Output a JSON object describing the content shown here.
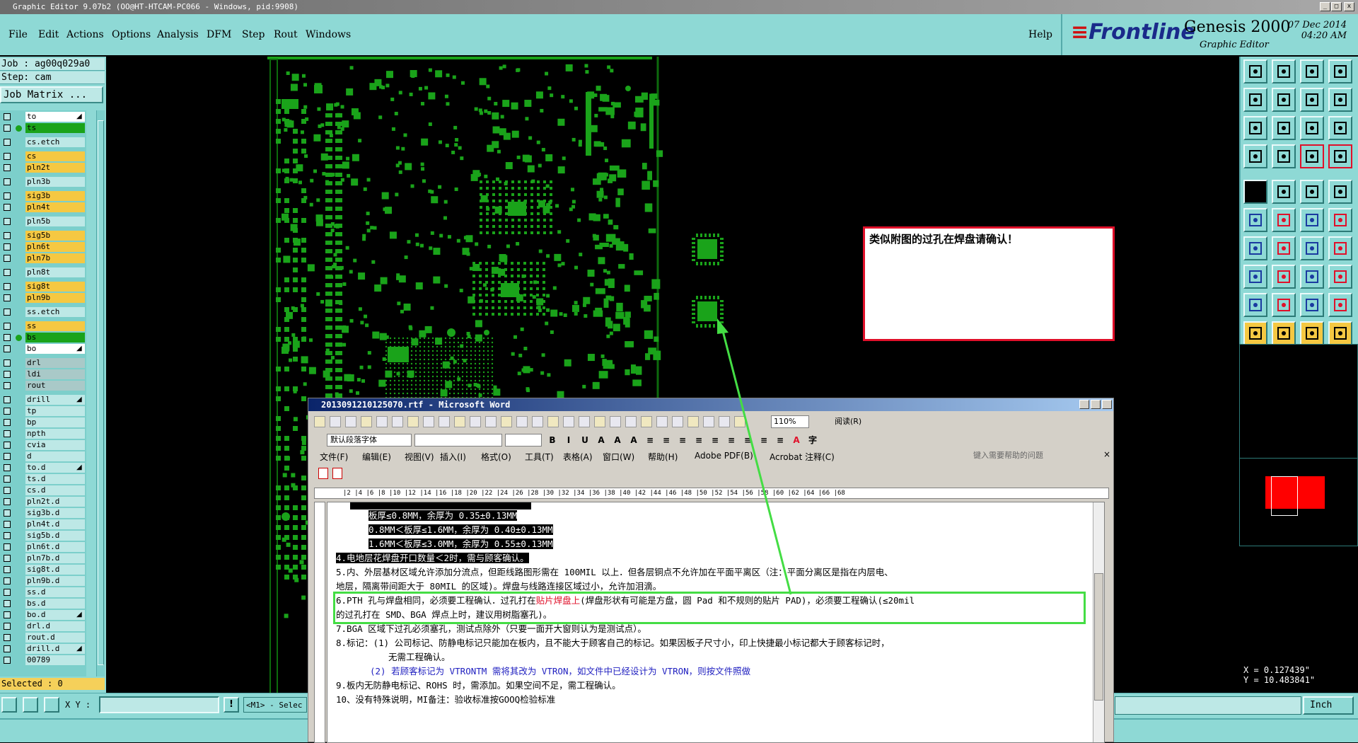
{
  "window": {
    "title": "Graphic Editor 9.07b2 (OO@HT-HTCAM-PC066 - Windows, pid:9908)",
    "controls": [
      "_",
      "□",
      "x"
    ]
  },
  "menu": {
    "items": [
      "File",
      "Edit",
      "Actions",
      "Options",
      "Analysis",
      "DFM",
      "Step",
      "Rout",
      "Windows"
    ],
    "help": "Help"
  },
  "brand": {
    "logo": "Frontline",
    "product": "Genesis 2000",
    "subtitle": "Graphic Editor",
    "date": "07 Dec 2014",
    "time": "04:20 AM"
  },
  "job": {
    "job_label": "Job : ag00q029a0",
    "step_label": "Step: cam",
    "matrix_button": "Job Matrix ..."
  },
  "layers": [
    {
      "name": "to",
      "style": "white",
      "arrow": true
    },
    {
      "name": "ts",
      "style": "green"
    },
    {
      "name": "cs.etch",
      "style": "cyan"
    },
    {
      "name": "cs",
      "style": "orange"
    },
    {
      "name": "pln2t",
      "style": "orange"
    },
    {
      "name": "pln3b",
      "style": "cyan"
    },
    {
      "name": "sig3b",
      "style": "orange"
    },
    {
      "name": "pln4t",
      "style": "orange"
    },
    {
      "name": "pln5b",
      "style": "cyan"
    },
    {
      "name": "sig5b",
      "style": "orange"
    },
    {
      "name": "pln6t",
      "style": "orange"
    },
    {
      "name": "pln7b",
      "style": "orange"
    },
    {
      "name": "pln8t",
      "style": "cyan"
    },
    {
      "name": "sig8t",
      "style": "orange"
    },
    {
      "name": "pln9b",
      "style": "orange"
    },
    {
      "name": "ss.etch",
      "style": "cyan"
    },
    {
      "name": "ss",
      "style": "orange"
    },
    {
      "name": "bs",
      "style": "green"
    },
    {
      "name": "bo",
      "style": "white",
      "arrow": true
    },
    {
      "name": "drl",
      "style": "grey"
    },
    {
      "name": "ldi",
      "style": "grey"
    },
    {
      "name": "rout",
      "style": "grey"
    },
    {
      "name": "drill",
      "style": "cyan",
      "arrow": true
    },
    {
      "name": "tp",
      "style": "cyan"
    },
    {
      "name": "bp",
      "style": "cyan"
    },
    {
      "name": "npth",
      "style": "cyan"
    },
    {
      "name": "cvia",
      "style": "cyan"
    },
    {
      "name": "d",
      "style": "cyan"
    },
    {
      "name": "to.d",
      "style": "cyan",
      "arrow": true
    },
    {
      "name": "ts.d",
      "style": "cyan"
    },
    {
      "name": "cs.d",
      "style": "cyan"
    },
    {
      "name": "pln2t.d",
      "style": "cyan"
    },
    {
      "name": "sig3b.d",
      "style": "cyan"
    },
    {
      "name": "pln4t.d",
      "style": "cyan"
    },
    {
      "name": "sig5b.d",
      "style": "cyan"
    },
    {
      "name": "pln6t.d",
      "style": "cyan"
    },
    {
      "name": "pln7b.d",
      "style": "cyan"
    },
    {
      "name": "sig8t.d",
      "style": "cyan"
    },
    {
      "name": "pln9b.d",
      "style": "cyan"
    },
    {
      "name": "ss.d",
      "style": "cyan"
    },
    {
      "name": "bs.d",
      "style": "cyan"
    },
    {
      "name": "bo.d",
      "style": "cyan",
      "arrow": true
    },
    {
      "name": "drl.d",
      "style": "cyan"
    },
    {
      "name": "rout.d",
      "style": "cyan"
    },
    {
      "name": "drill.d",
      "style": "cyan",
      "arrow": true
    },
    {
      "name": "00789",
      "style": "cyan"
    }
  ],
  "selected_label": "Selected : 0",
  "statusbar": {
    "xy_label": "X Y :",
    "xy_value": "",
    "mode_text": "<M1> - Selec",
    "units": "Inch"
  },
  "coords": {
    "x": "X = 0.127439\"",
    "y": "Y = 10.483841\""
  },
  "note": {
    "text": "类似附图的过孔在焊盘请确认！"
  },
  "word": {
    "title": "2013091210125070.rtf - Microsoft Word",
    "style_box": "默认段落字体",
    "zoom": "110%",
    "read_button": "阅读(R)",
    "menus": [
      "文件(F)",
      "编辑(E)",
      "视图(V)",
      "插入(I)",
      "格式(O)",
      "工具(T)",
      "表格(A)",
      "窗口(W)",
      "帮助(H)",
      "Adobe PDF(B)",
      "Acrobat 注释(C)"
    ],
    "help_placeholder": "键入需要帮助的问题",
    "ruler": "|2 |4 |6 |8 |10 |12 |14 |16 |18 |20 |22 |24 |26 |28 |30 |32 |34 |36 |38 |40 |42 |44 |46 |48 |50 |52 |54 |56 |58 |60 |62 |64 |66 |68",
    "lines": [
      "板厚≤0.8MM，余厚为 0.35±0.13MM",
      "0.8MM＜板厚≤1.6MM，余厚为 0.40±0.13MM",
      "1.6MM＜板厚≤3.0MM，余厚为 0.55±0.13MM",
      "4.电地层花焊盘开口数量＜2时，需与顾客确认。",
      "5.内、外层基材区域允许添加分流点，但距线路图形需在 100MIL 以上．但各层铜点不允许加在平面平离区（注：平面分离区是指在内层电、",
      "地层，隔离带间距大于 80MIL 的区域)。焊盘与线路连接区域过小，允许加泪滴。",
      "6.PTH 孔与焊盘相同，必须要工程确认．过孔打在",
      "贴片焊盘上",
      "(焊盘形状有可能是方盘，圆 Pad 和不规则的贴片 PAD)，必须要工程确认(≤20mil",
      "的过孔打在 SMD、BGA 焊点上时，建议用树脂塞孔)。",
      "7.BGA 区域下过孔必须塞孔，测试点除外（只要一面开大窗则认为是测试点）。",
      "8.标记：(1) 公司标记、防静电标记只能加在板内，且不能大于顾客自己的标记。如果因板子尺寸小，印上快捷最小标记都大于顾客标记时，",
      "无需工程确认。",
      "(2) 若顾客标记为 VTRONTM 需将其改为 VTRON，如文件中已经设计为 VTRON，则按文件照做",
      "9.板内无防静电标记、ROHS 时，需添加。如果空间不足，需工程确认。",
      "10、没有特殊说明，MI备注：验收标准按GOOQ检验标准"
    ]
  },
  "colors": {
    "panel": "#8ed9d5",
    "copper": "#1aa31a",
    "highlight_red": "#e0102a",
    "annotation_green": "#44dd44",
    "layer_orange": "#f5c842"
  }
}
